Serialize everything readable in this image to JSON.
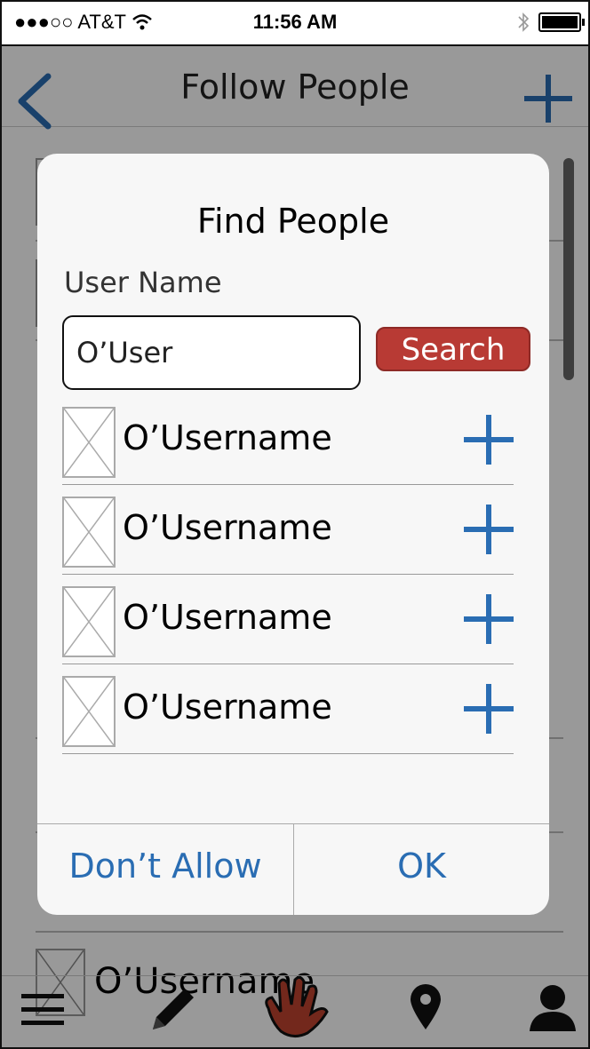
{
  "status": {
    "carrier": "●●●○○ AT&T",
    "time": "11:56 AM"
  },
  "nav": {
    "title": "Follow People"
  },
  "background_list": {
    "visible_name": "O’Username"
  },
  "dialog": {
    "title": "Find People",
    "user_label": "User Name",
    "search_value": "O’User",
    "search_button": "Search",
    "results": [
      {
        "name": "O’Username"
      },
      {
        "name": "O’Username"
      },
      {
        "name": "O’Username"
      },
      {
        "name": "O’Username"
      }
    ],
    "cancel_label": "Don’t Allow",
    "ok_label": "OK"
  },
  "colors": {
    "accent": "#2a6db3",
    "search_button": "#b83a34"
  }
}
